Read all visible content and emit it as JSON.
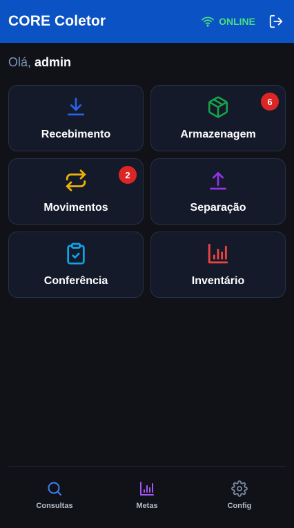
{
  "header": {
    "title": "CORE Coletor",
    "status": "ONLINE",
    "status_icon": "wifi-icon",
    "logout_icon": "logout-icon"
  },
  "greeting": {
    "prefix": "Olá,",
    "user": "admin"
  },
  "modules": [
    {
      "label": "Recebimento",
      "icon": "download-icon",
      "color": "#2563eb",
      "badge": null
    },
    {
      "label": "Armazenagem",
      "icon": "box-icon",
      "color": "#16a34a",
      "badge": "6"
    },
    {
      "label": "Movimentos",
      "icon": "swap-icon",
      "color": "#eab308",
      "badge": "2"
    },
    {
      "label": "Separação",
      "icon": "upload-icon",
      "color": "#9333ea",
      "badge": null
    },
    {
      "label": "Conferência",
      "icon": "clipboard-check-icon",
      "color": "#0ea5e9",
      "badge": null
    },
    {
      "label": "Inventário",
      "icon": "bar-chart-icon",
      "color": "#ef4444",
      "badge": null
    }
  ],
  "bottom_nav": [
    {
      "label": "Consultas",
      "icon": "search-icon",
      "color": "#3b82f6"
    },
    {
      "label": "Metas",
      "icon": "bar-chart-icon",
      "color": "#a855f7"
    },
    {
      "label": "Config",
      "icon": "gear-icon",
      "color": "#7c8ba6"
    }
  ],
  "colors": {
    "header_bg": "#0b52c4",
    "online": "#4ade80",
    "badge": "#dc2626",
    "card_bg": "#151a2a"
  }
}
